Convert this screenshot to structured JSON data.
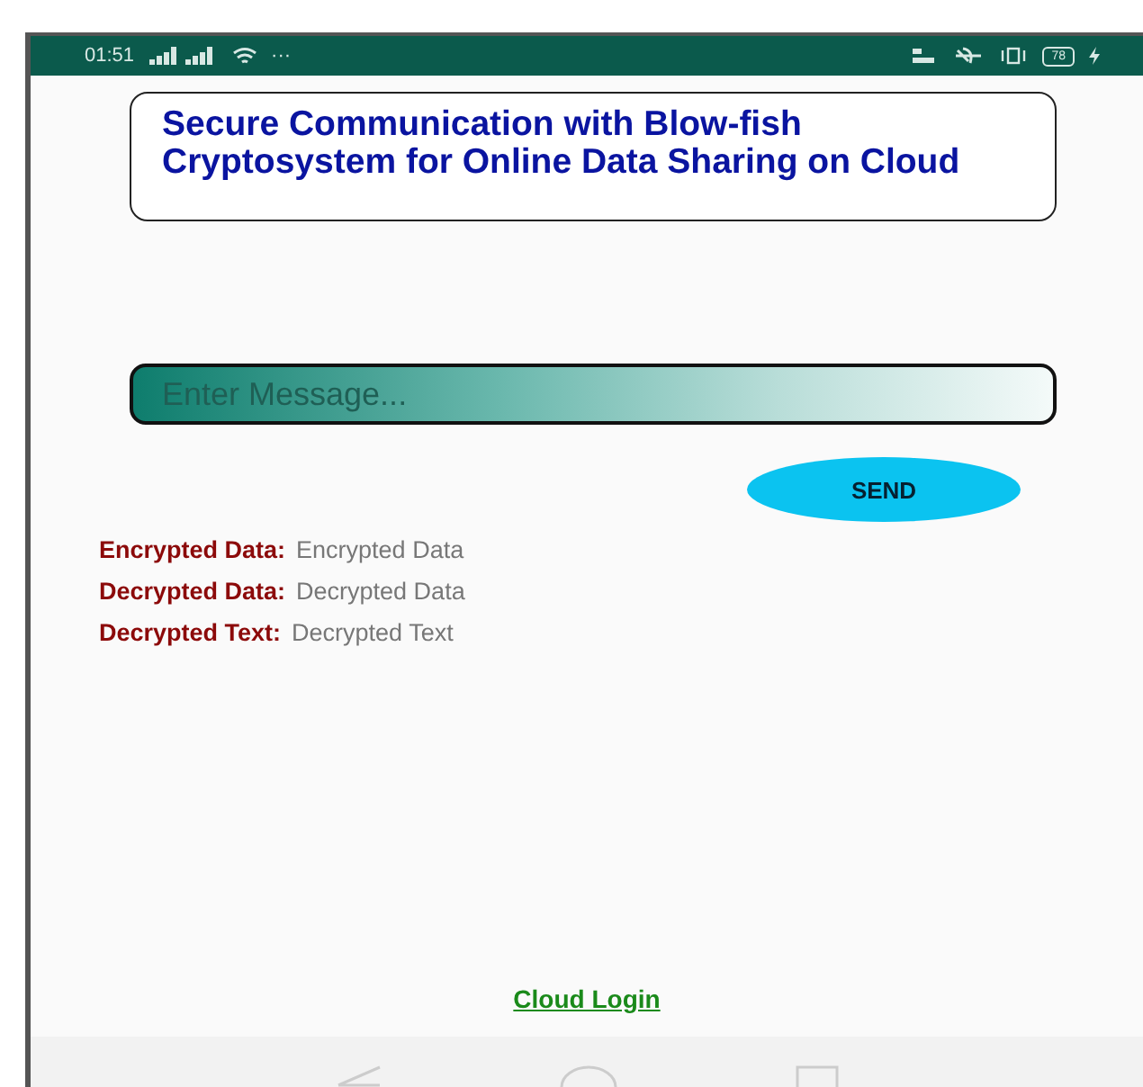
{
  "status_bar": {
    "time": "01:51",
    "more": "···",
    "battery": "78"
  },
  "title": "Secure Communication with Blow-fish Cryptosystem for Online Data Sharing on Cloud",
  "message_field": {
    "placeholder": "Enter Message..."
  },
  "send_button": "SEND",
  "results": [
    {
      "label": "Encrypted Data:",
      "value": "Encrypted Data"
    },
    {
      "label": "Decrypted Data:",
      "value": "Decrypted Data"
    },
    {
      "label": "Decrypted Text:",
      "value": "Decrypted Text"
    }
  ],
  "cloud_login_link": "Cloud Login"
}
